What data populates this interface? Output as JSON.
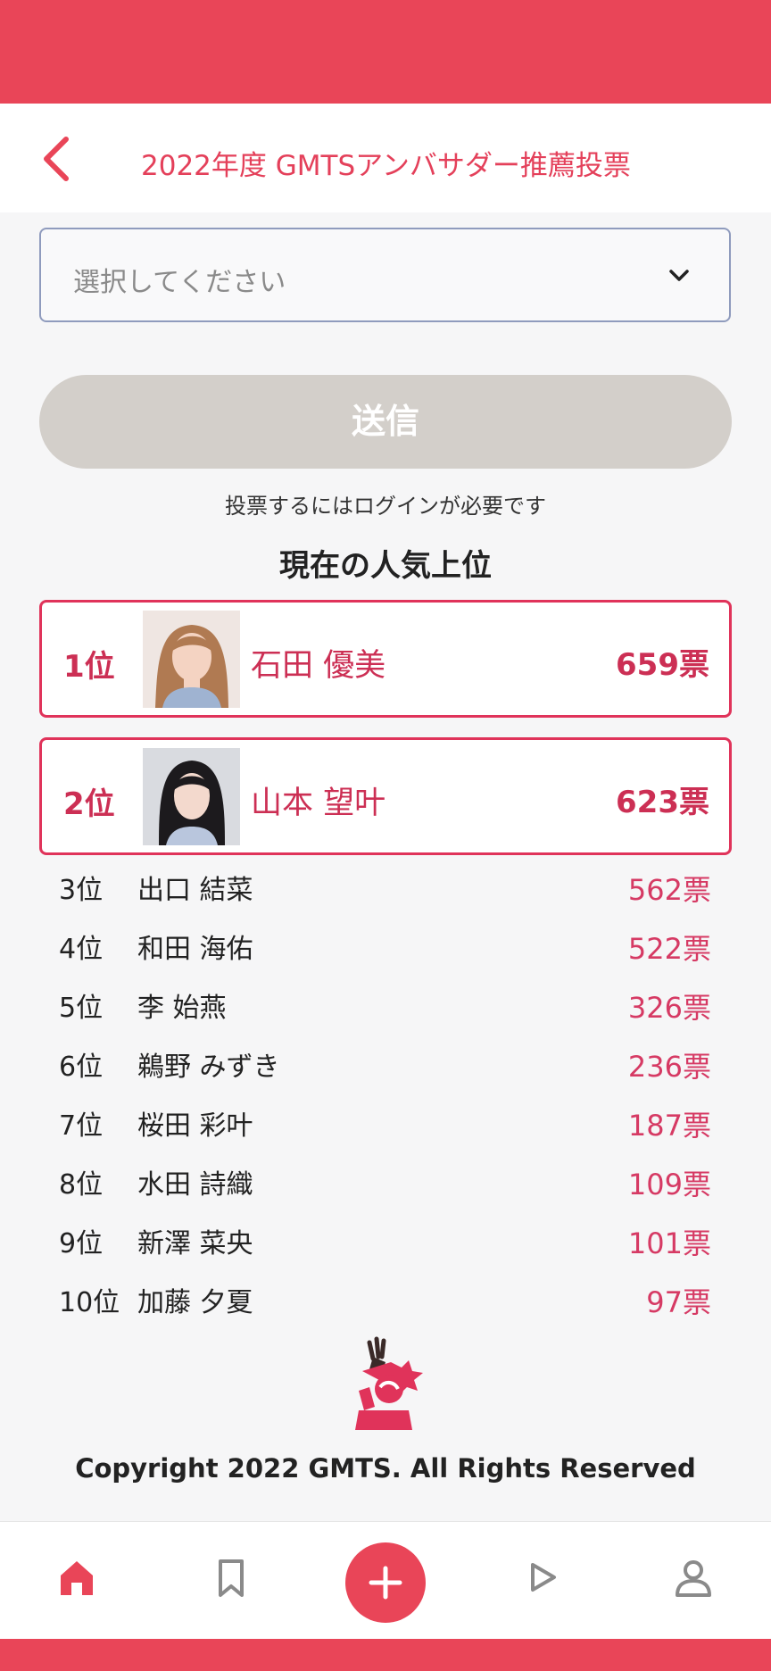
{
  "header": {
    "title": "2022年度 GMTSアンバサダー推薦投票"
  },
  "select": {
    "placeholder": "選択してください"
  },
  "submit_label": "送信",
  "login_note": "投票するにはログインが必要です",
  "ranking_title": "現在の人気上位",
  "top": [
    {
      "rank": "1位",
      "name": "石田 優美",
      "votes": "659票"
    },
    {
      "rank": "2位",
      "name": "山本 望叶",
      "votes": "623票"
    }
  ],
  "rows": [
    {
      "rank": "3位",
      "name": "出口 結菜",
      "votes": "562票"
    },
    {
      "rank": "4位",
      "name": "和田 海佑",
      "votes": "522票"
    },
    {
      "rank": "5位",
      "name": "李 始燕",
      "votes": "326票"
    },
    {
      "rank": "6位",
      "name": "鵜野 みずき",
      "votes": "236票"
    },
    {
      "rank": "7位",
      "name": "桜田 彩叶",
      "votes": "187票"
    },
    {
      "rank": "8位",
      "name": "水田 詩織",
      "votes": "109票"
    },
    {
      "rank": "9位",
      "name": "新澤 菜央",
      "votes": "101票"
    },
    {
      "rank": "10位",
      "name": "加藤 夕夏",
      "votes": "97票"
    }
  ],
  "footer": {
    "copyright": "Copyright 2022 GMTS. All Rights Reserved"
  },
  "tabbar": {
    "icons": [
      "home-icon",
      "bookmark-icon",
      "plus-icon",
      "play-icon",
      "user-icon"
    ]
  },
  "colors": {
    "brand": "#e94558",
    "accent": "#cc2f54",
    "button_disabled": "#d3cfca"
  }
}
